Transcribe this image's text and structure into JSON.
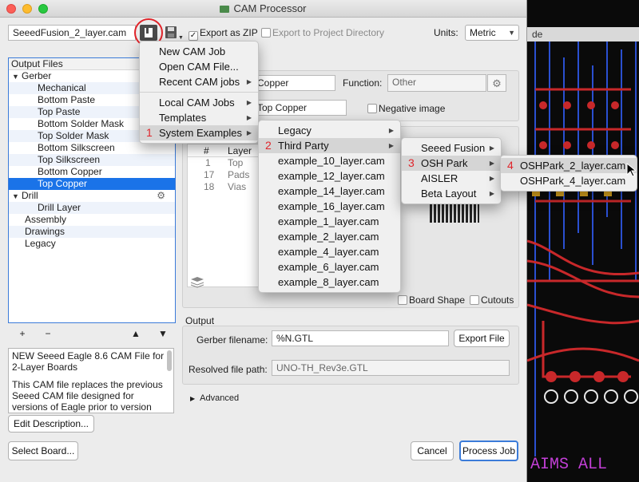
{
  "window": {
    "title": "CAM Processor"
  },
  "toolbar": {
    "job_name": "SeeedFusion_2_layer.cam",
    "export_zip": "Export as ZIP",
    "export_project": "Export to Project Directory",
    "units_label": "Units:",
    "units_value": "Metric"
  },
  "tree": {
    "header": "Output Files",
    "items": [
      {
        "label": "Gerber",
        "level": 0,
        "expander": "▼"
      },
      {
        "label": "Mechanical",
        "level": 2
      },
      {
        "label": "Bottom Paste",
        "level": 2
      },
      {
        "label": "Top Paste",
        "level": 2
      },
      {
        "label": "Bottom Solder Mask",
        "level": 2
      },
      {
        "label": "Top Solder Mask",
        "level": 2
      },
      {
        "label": "Bottom Silkscreen",
        "level": 2
      },
      {
        "label": "Top Silkscreen",
        "level": 2
      },
      {
        "label": "Bottom Copper",
        "level": 2
      },
      {
        "label": "Top Copper",
        "level": 2,
        "selected": true
      },
      {
        "label": "Drill",
        "level": 0,
        "expander": "▼"
      },
      {
        "label": "Drill Layer",
        "level": 2
      },
      {
        "label": "Assembly",
        "level": 1
      },
      {
        "label": "Drawings",
        "level": 1
      },
      {
        "label": "Legacy",
        "level": 1
      }
    ],
    "tools": {
      "add": "+",
      "remove": "−",
      "up": "🡅",
      "down": "🡇"
    }
  },
  "description": {
    "para1": "NEW Seeed Eagle 8.6 CAM File for 2-Layer Boards",
    "para2": "This CAM file replaces the previous Seeed CAM file designed for versions of Eagle prior to version",
    "edit_button": "Edit Description..."
  },
  "detail": {
    "name_value": "Copper",
    "function_label": "Function:",
    "function_placeholder": "Other",
    "layer_value": "Top Copper",
    "negative_image": "Negative image",
    "table_headers": [
      "#",
      "Layer"
    ],
    "table_rows": [
      {
        "num": "1",
        "layer": "Top"
      },
      {
        "num": "17",
        "layer": "Pads"
      },
      {
        "num": "18",
        "layer": "Vias"
      }
    ],
    "board_shape": "Board Shape",
    "cutouts": "Cutouts"
  },
  "output": {
    "section": "Output",
    "gerber_label": "Gerber filename:",
    "gerber_value": "%N.GTL",
    "export_file": "Export File",
    "resolved_label": "Resolved file path:",
    "resolved_value": "UNO-TH_Rev3e.GTL",
    "advanced": "Advanced"
  },
  "buttons": {
    "select_board": "Select Board...",
    "cancel": "Cancel",
    "process_job": "Process Job"
  },
  "menu1": {
    "items": [
      "New CAM Job",
      "Open CAM File...",
      "Recent CAM jobs",
      "Local CAM Jobs",
      "Templates",
      "System Examples"
    ],
    "step": "1"
  },
  "menu2": {
    "items": [
      "Legacy",
      "Third Party",
      "example_10_layer.cam",
      "example_12_layer.cam",
      "example_14_layer.cam",
      "example_16_layer.cam",
      "example_1_layer.cam",
      "example_2_layer.cam",
      "example_4_layer.cam",
      "example_6_layer.cam",
      "example_8_layer.cam"
    ],
    "step": "2"
  },
  "menu3": {
    "items": [
      "Seeed Fusion",
      "OSH Park",
      "AISLER",
      "Beta Layout"
    ],
    "step": "3"
  },
  "menu4": {
    "items": [
      "OSHPark_2_layer.cam",
      "OSHPark_4_layer.cam"
    ],
    "step": "4"
  },
  "pcb": {
    "tab_label": "de",
    "board_text": "AIMS ALL"
  },
  "colors": {
    "accent": "#1a73e8",
    "highlight_red": "#e0242a",
    "pcb_copper": "#c8282a",
    "pcb_blue": "#2a4fd0"
  }
}
